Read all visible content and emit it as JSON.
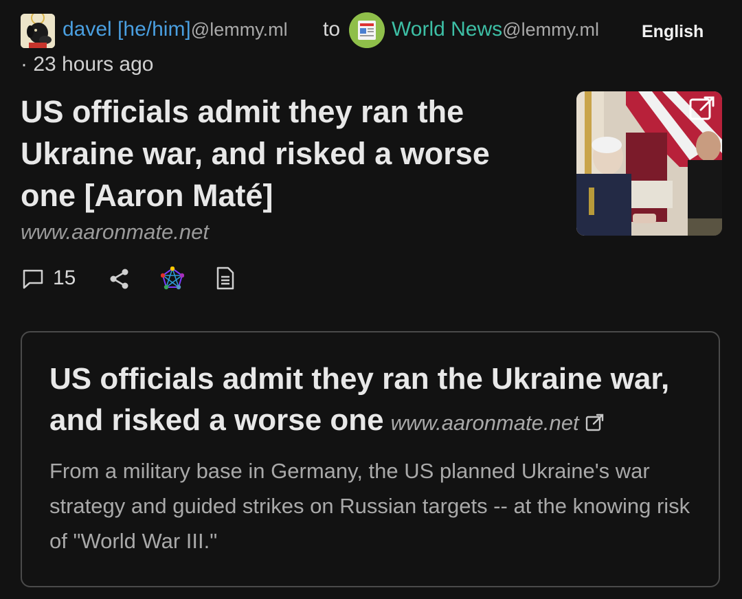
{
  "post": {
    "author": {
      "name": "davel [he/him]",
      "instance": "@lemmy.ml",
      "avatar_icon": "dog-avatar-icon"
    },
    "to_word": "to",
    "community": {
      "name": "World News",
      "instance": "@lemmy.ml",
      "icon": "newspaper-icon"
    },
    "language": "English",
    "time": "· 23 hours ago",
    "title": "US officials admit they ran the Ukraine war, and risked a worse one [Aaron Maté]",
    "domain": "www.aaronmate.net",
    "thumbnail_icon": "open-external-icon",
    "actions": {
      "comments_count": "15",
      "comment_icon": "comment-icon",
      "share_icon": "share-icon",
      "fediverse_icon": "fediverse-icon",
      "document_icon": "document-icon"
    }
  },
  "embed": {
    "title": "US officials admit they ran the Ukraine war, and risked a worse one",
    "domain": "www.aaronmate.net",
    "description": "From a military base in Germany, the US planned Ukraine's war strategy and guided strikes on Russian targets -- at the knowing risk of \"World War III.\"",
    "link_icon": "external-link-icon"
  },
  "colors": {
    "background": "#121212",
    "user_link": "#4a9fe0",
    "community_link": "#3dbfa5",
    "muted_text": "#a9a9a9",
    "card_border": "#4a4a4a"
  }
}
